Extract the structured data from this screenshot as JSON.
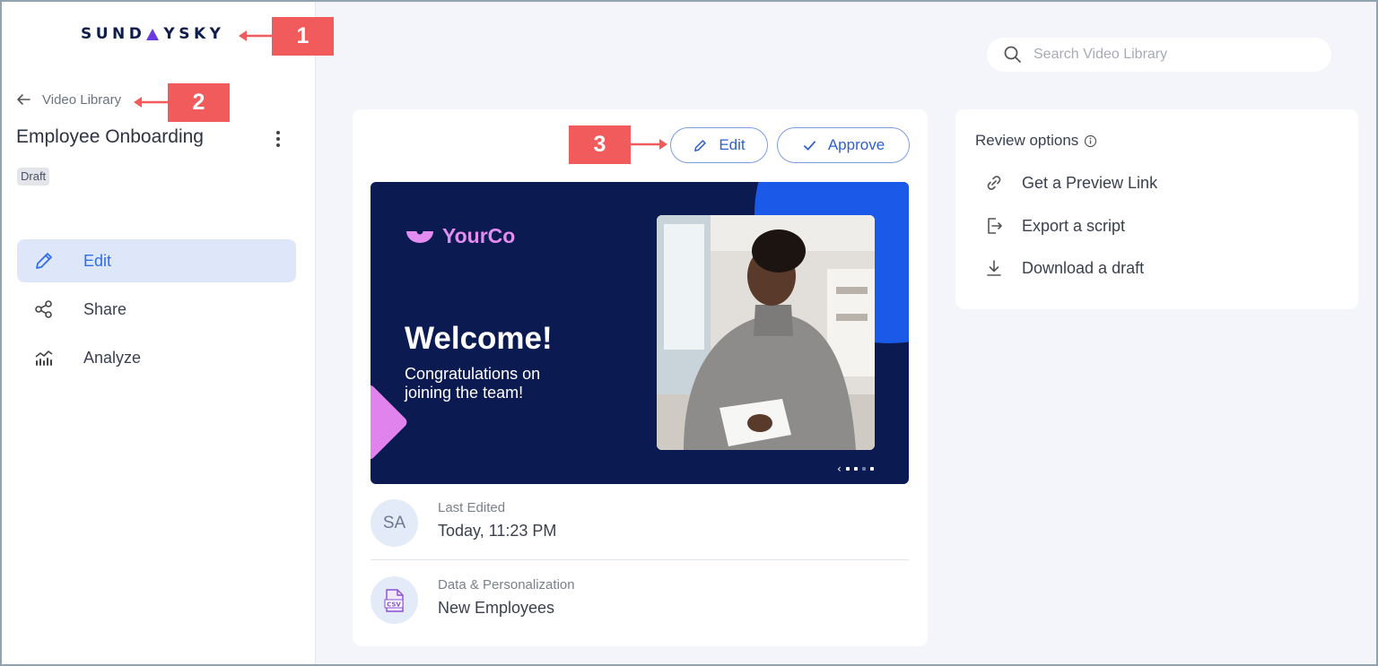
{
  "sidebar": {
    "logo_text": "SUNDAYSKY",
    "logo_left": "SUND",
    "logo_right": "YSKY",
    "back_label": "Video Library",
    "video_title": "Employee Onboarding",
    "status_badge": "Draft",
    "nav": [
      {
        "label": "Edit",
        "icon": "pencil-icon",
        "active": true
      },
      {
        "label": "Share",
        "icon": "share-icon",
        "active": false
      },
      {
        "label": "Analyze",
        "icon": "analytics-icon",
        "active": false
      }
    ]
  },
  "search": {
    "placeholder": "Search Video Library",
    "value": ""
  },
  "toolbar": {
    "edit_label": "Edit",
    "approve_label": "Approve"
  },
  "video_preview": {
    "brand": "YourCo",
    "headline": "Welcome!",
    "subtext": "Congratulations on joining the team!",
    "slide_indicator": {
      "current": 1,
      "total": 4
    }
  },
  "details": {
    "last_edited": {
      "avatar_initials": "SA",
      "label": "Last Edited",
      "value": "Today, 11:23 PM"
    },
    "data": {
      "icon": "csv-file-icon",
      "label": "Data & Personalization",
      "value": "New Employees"
    }
  },
  "review": {
    "title": "Review options",
    "options": [
      {
        "label": "Get a Preview Link",
        "icon": "link-icon"
      },
      {
        "label": "Export a script",
        "icon": "export-icon"
      },
      {
        "label": "Download a draft",
        "icon": "download-icon"
      }
    ]
  },
  "callouts": [
    "1",
    "2",
    "3"
  ],
  "colors": {
    "accent": "#2f6ee8",
    "callout": "#f25b5b",
    "video_bg": "#0b1b52",
    "brand_pink": "#e38df0",
    "active_nav_bg": "#dee7fa"
  }
}
